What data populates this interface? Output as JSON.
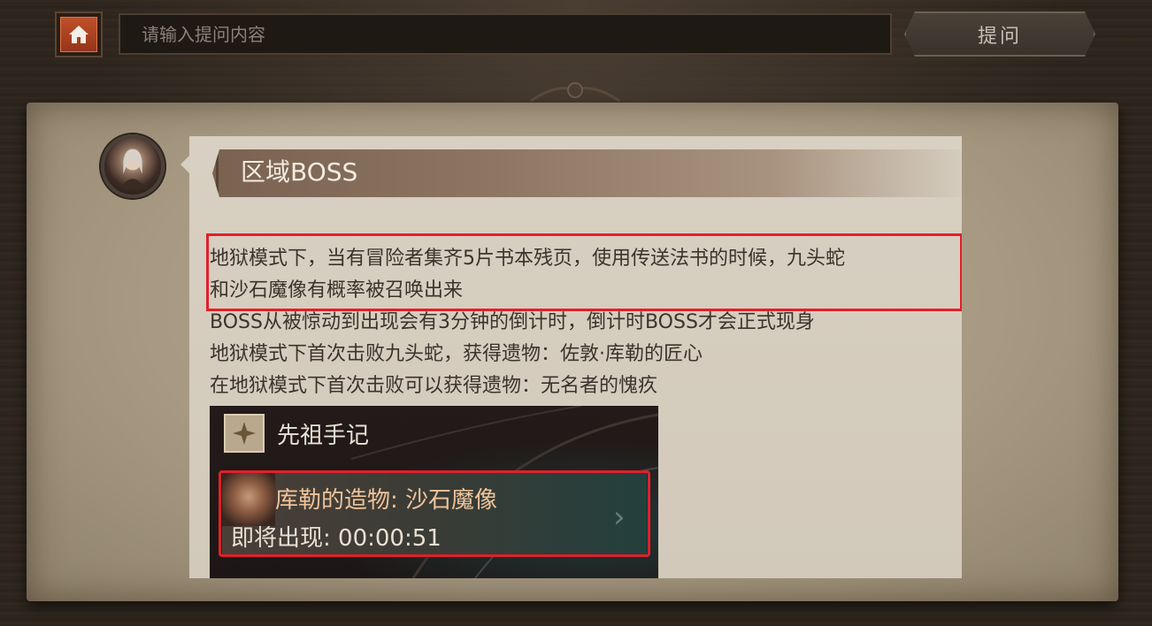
{
  "topbar": {
    "search_placeholder": "请输入提问内容",
    "ask_label": "提问"
  },
  "card": {
    "section_title": "区域BOSS",
    "lines": [
      "地狱模式下，当有冒险者集齐5片书本残页，使用传送法书的时候，九头蛇",
      "和沙石魔像有概率被召唤出来",
      "BOSS从被惊动到出现会有3分钟的倒计时，倒计时BOSS才会正式现身",
      "地狱模式下首次击败九头蛇，获得遗物：佐敦·库勒的匠心",
      "在地狱模式下首次击败可以获得遗物：无名者的愧疚"
    ]
  },
  "inset": {
    "title": "先祖手记",
    "boss_name": "库勒的造物: 沙石魔像",
    "timer": "即将出现: 00:00:51"
  },
  "icons": {
    "home": "home-icon",
    "avatar": "avatar-portrait",
    "journal": "compass-star-icon",
    "chevron": "chevron-right-icon"
  },
  "colors": {
    "home_accent": "#b5421f",
    "highlight_box": "#e0202a",
    "parchment": "#a89a82",
    "boss_name": "#f0c39a"
  }
}
